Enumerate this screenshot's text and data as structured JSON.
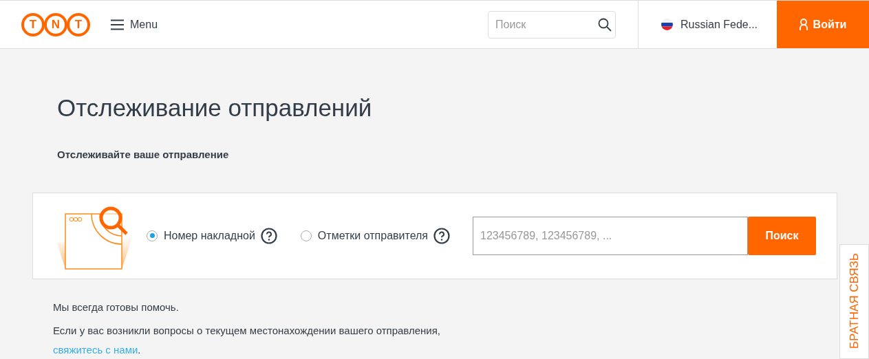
{
  "header": {
    "logo_letters": [
      "T",
      "N",
      "T"
    ],
    "menu_label": "Menu",
    "search": {
      "placeholder": "Поиск"
    },
    "country": "Russian Fede...",
    "login_label": "Войти"
  },
  "title": "Отслеживание отправлений",
  "subtitle": "Отслеживайте ваше отправление",
  "tracking": {
    "options": [
      {
        "label": "Номер накладной",
        "selected": true
      },
      {
        "label": "Отметки отправителя",
        "selected": false
      }
    ],
    "input": {
      "placeholder": "123456789, 123456789, ..."
    },
    "button": "Поиск"
  },
  "help": {
    "heading": "Мы всегда готовы помочь.",
    "text": "Если у вас возникли вопросы о текущем местонахождении вашего отправления,",
    "link": "свяжитесь с нами",
    "after_link": "."
  },
  "feedback_tab": "БРАТНАЯ СВЯЗЬ"
}
